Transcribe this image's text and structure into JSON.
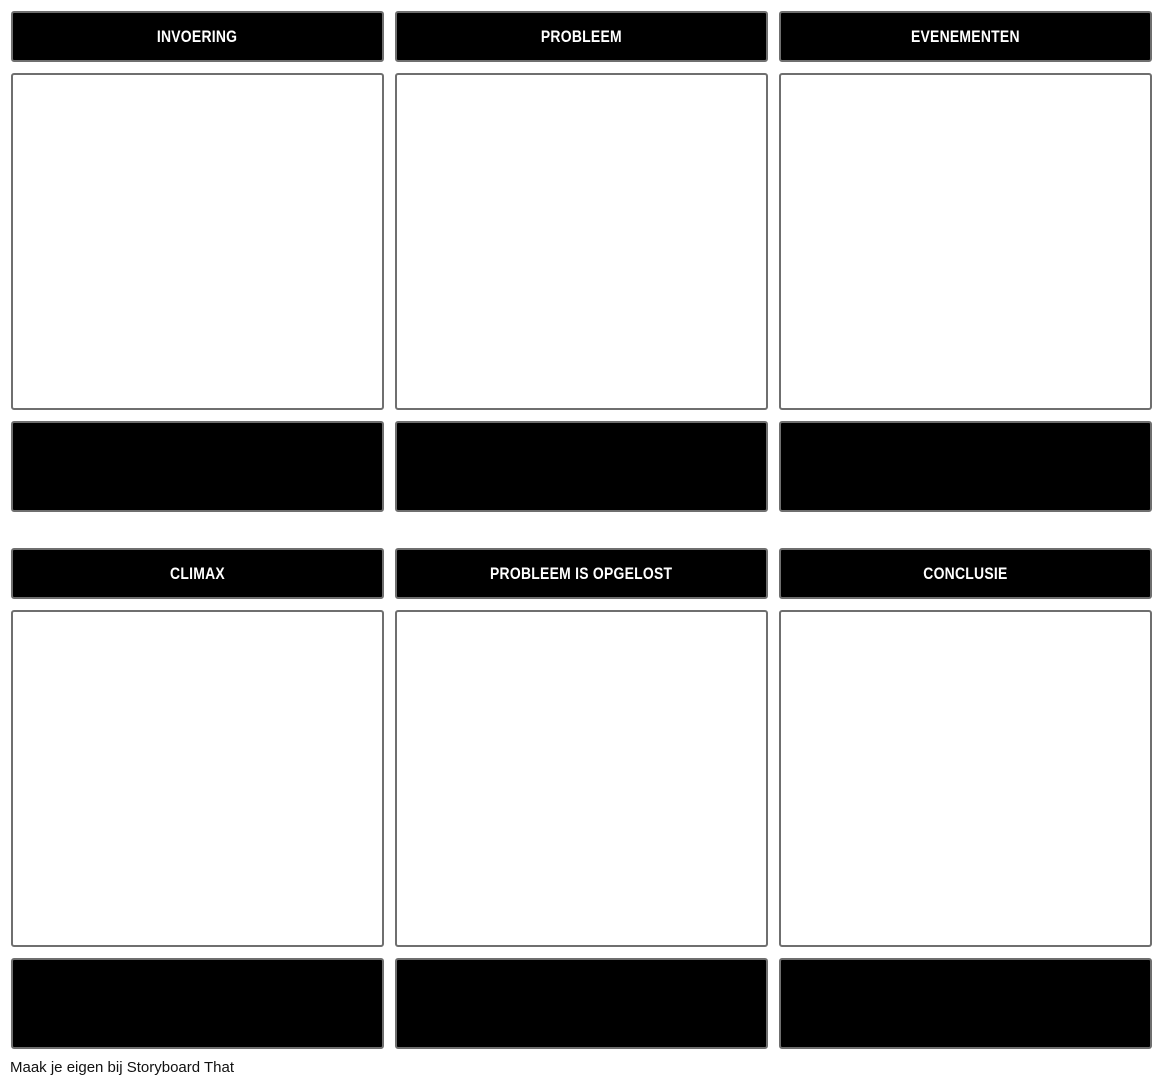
{
  "storyboard": {
    "rows": [
      {
        "cells": [
          {
            "title": "INVOERING",
            "description": ""
          },
          {
            "title": "PROBLEEM",
            "description": ""
          },
          {
            "title": "EVENEMENTEN",
            "description": ""
          }
        ]
      },
      {
        "cells": [
          {
            "title": "CLIMAX",
            "description": ""
          },
          {
            "title": "PROBLEEM IS OPGELOST",
            "description": ""
          },
          {
            "title": "CONCLUSIE",
            "description": ""
          }
        ]
      }
    ]
  },
  "footer": {
    "text": "Maak je eigen bij Storyboard That"
  },
  "colors": {
    "title_bg": "#000000",
    "title_text": "#ffffff",
    "border": "#6f6f6f",
    "image_bg": "#ffffff",
    "description_bg": "#000000"
  }
}
